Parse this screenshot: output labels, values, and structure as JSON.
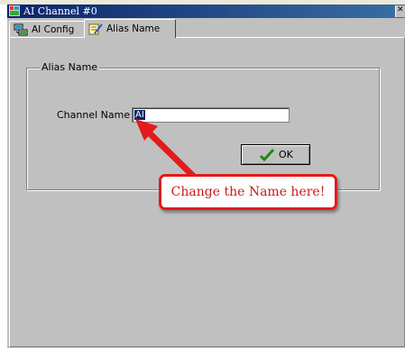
{
  "window": {
    "title": "AI Channel #0"
  },
  "tabs": [
    {
      "label": "AI Config",
      "icon": "network-config-icon",
      "active": false
    },
    {
      "label": "Alias Name",
      "icon": "edit-note-icon",
      "active": true
    }
  ],
  "alias_group": {
    "legend": "Alias Name",
    "channel_label": "Channel Name :",
    "channel_value": "AI"
  },
  "ok_button": {
    "label": "OK",
    "icon": "checkmark-icon"
  },
  "annotation": {
    "text": "Change the Name here!",
    "color": "#e31b1b"
  },
  "colors": {
    "titlebar": "#0a246a",
    "dialog_face": "#c0c0c0",
    "selection": "#0a246a"
  }
}
